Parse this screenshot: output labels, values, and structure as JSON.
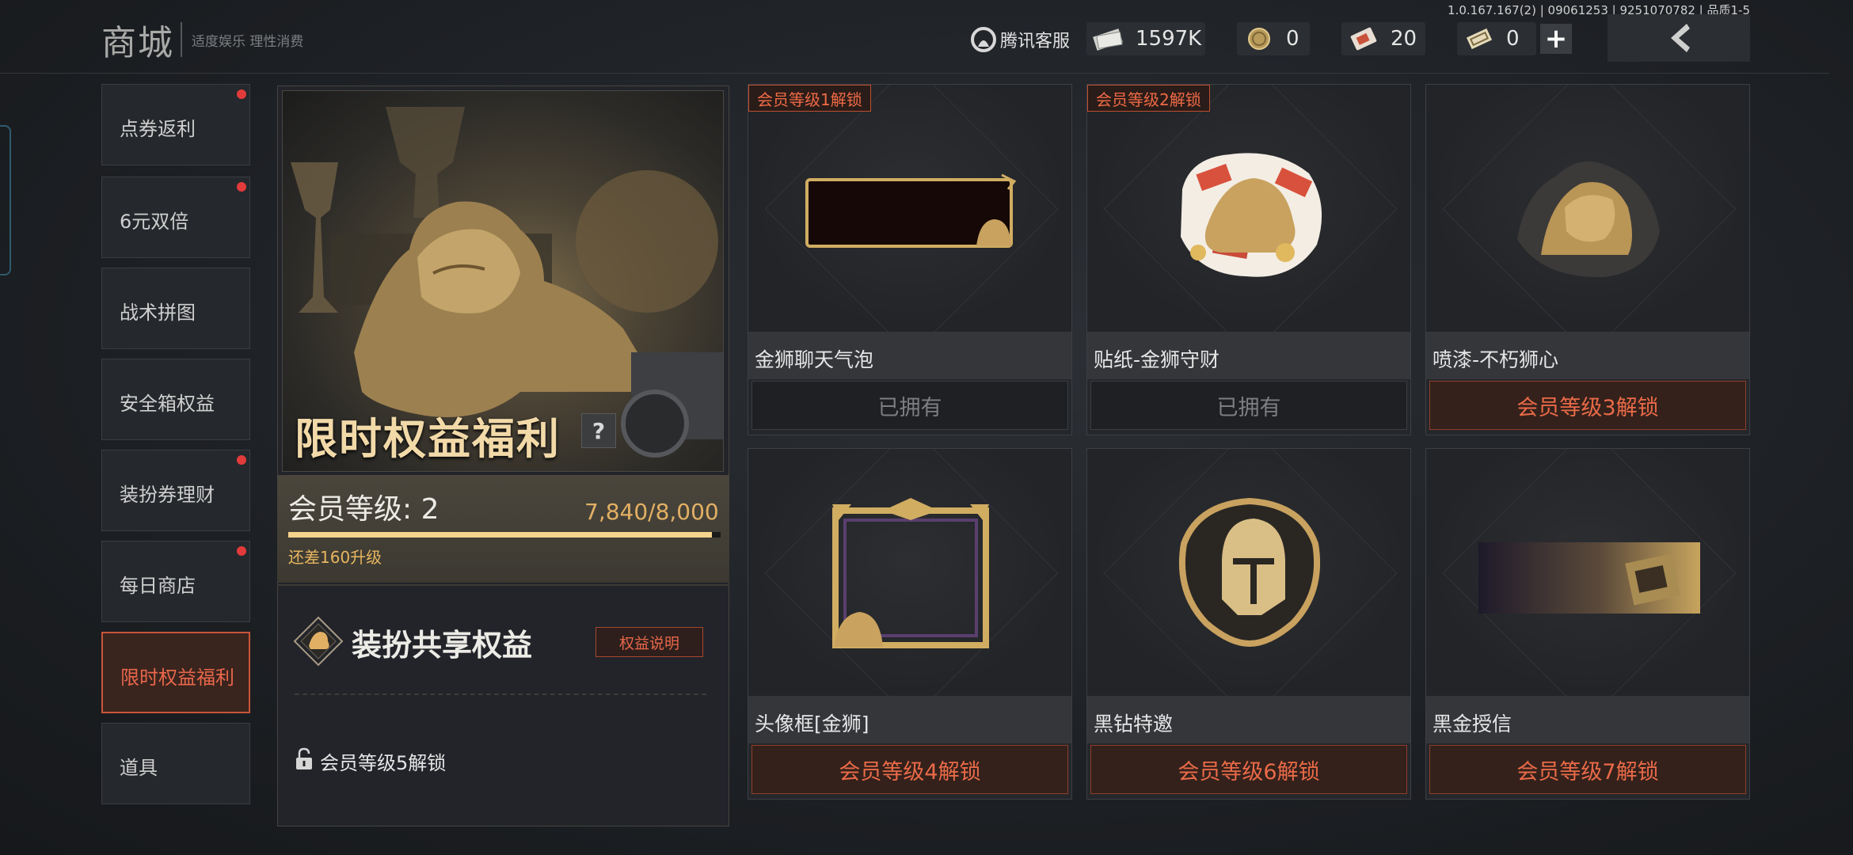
{
  "header": {
    "title": "商城",
    "slogan": "适度娱乐 理性消费",
    "version": "1.0.167.167(2) | 09061253 | 9251070782 | 品质1-5",
    "service_label": "腾讯客服",
    "resources": [
      {
        "icon": "cash-icon",
        "value": "1597K"
      },
      {
        "icon": "coin-icon",
        "value": "0"
      },
      {
        "icon": "ticket-icon",
        "value": "20"
      },
      {
        "icon": "voucher-icon",
        "value": "0"
      }
    ],
    "plus_label": "+"
  },
  "sidebar": {
    "items": [
      {
        "label": "点券返利",
        "dot": true
      },
      {
        "label": "6元双倍",
        "dot": true
      },
      {
        "label": "战术拼图",
        "dot": false
      },
      {
        "label": "安全箱权益",
        "dot": false
      },
      {
        "label": "装扮券理财",
        "dot": true
      },
      {
        "label": "每日商店",
        "dot": true
      },
      {
        "label": "限时权益福利",
        "dot": false,
        "active": true
      },
      {
        "label": "道具",
        "dot": false
      }
    ]
  },
  "feature": {
    "title": "限时权益福利",
    "help_label": "?",
    "level_text": "会员等级: 2",
    "progress_text": "7,840/8,000",
    "progress_fraction": 0.98,
    "progress_hint": "还差160升级",
    "share_title": "装扮共享权益",
    "rights_button": "权益说明",
    "lock_text": "会员等级5解锁"
  },
  "cards": [
    {
      "tag": "会员等级1解锁",
      "name": "金狮聊天气泡",
      "button": "已拥有",
      "state": "owned"
    },
    {
      "tag": "会员等级2解锁",
      "name": "贴纸-金狮守财",
      "button": "已拥有",
      "state": "owned"
    },
    {
      "tag": "",
      "name": "喷漆-不朽狮心",
      "button": "会员等级3解锁",
      "state": "locked"
    },
    {
      "tag": "",
      "name": "头像框[金狮]",
      "button": "会员等级4解锁",
      "state": "locked"
    },
    {
      "tag": "",
      "name": "黑钻特邀",
      "button": "会员等级6解锁",
      "state": "locked"
    },
    {
      "tag": "",
      "name": "黑金授信",
      "button": "会员等级7解锁",
      "state": "locked"
    }
  ],
  "colors": {
    "accent_orange": "#e8674a",
    "gold": "#e2b064",
    "notify_dot": "#e23b3b"
  }
}
